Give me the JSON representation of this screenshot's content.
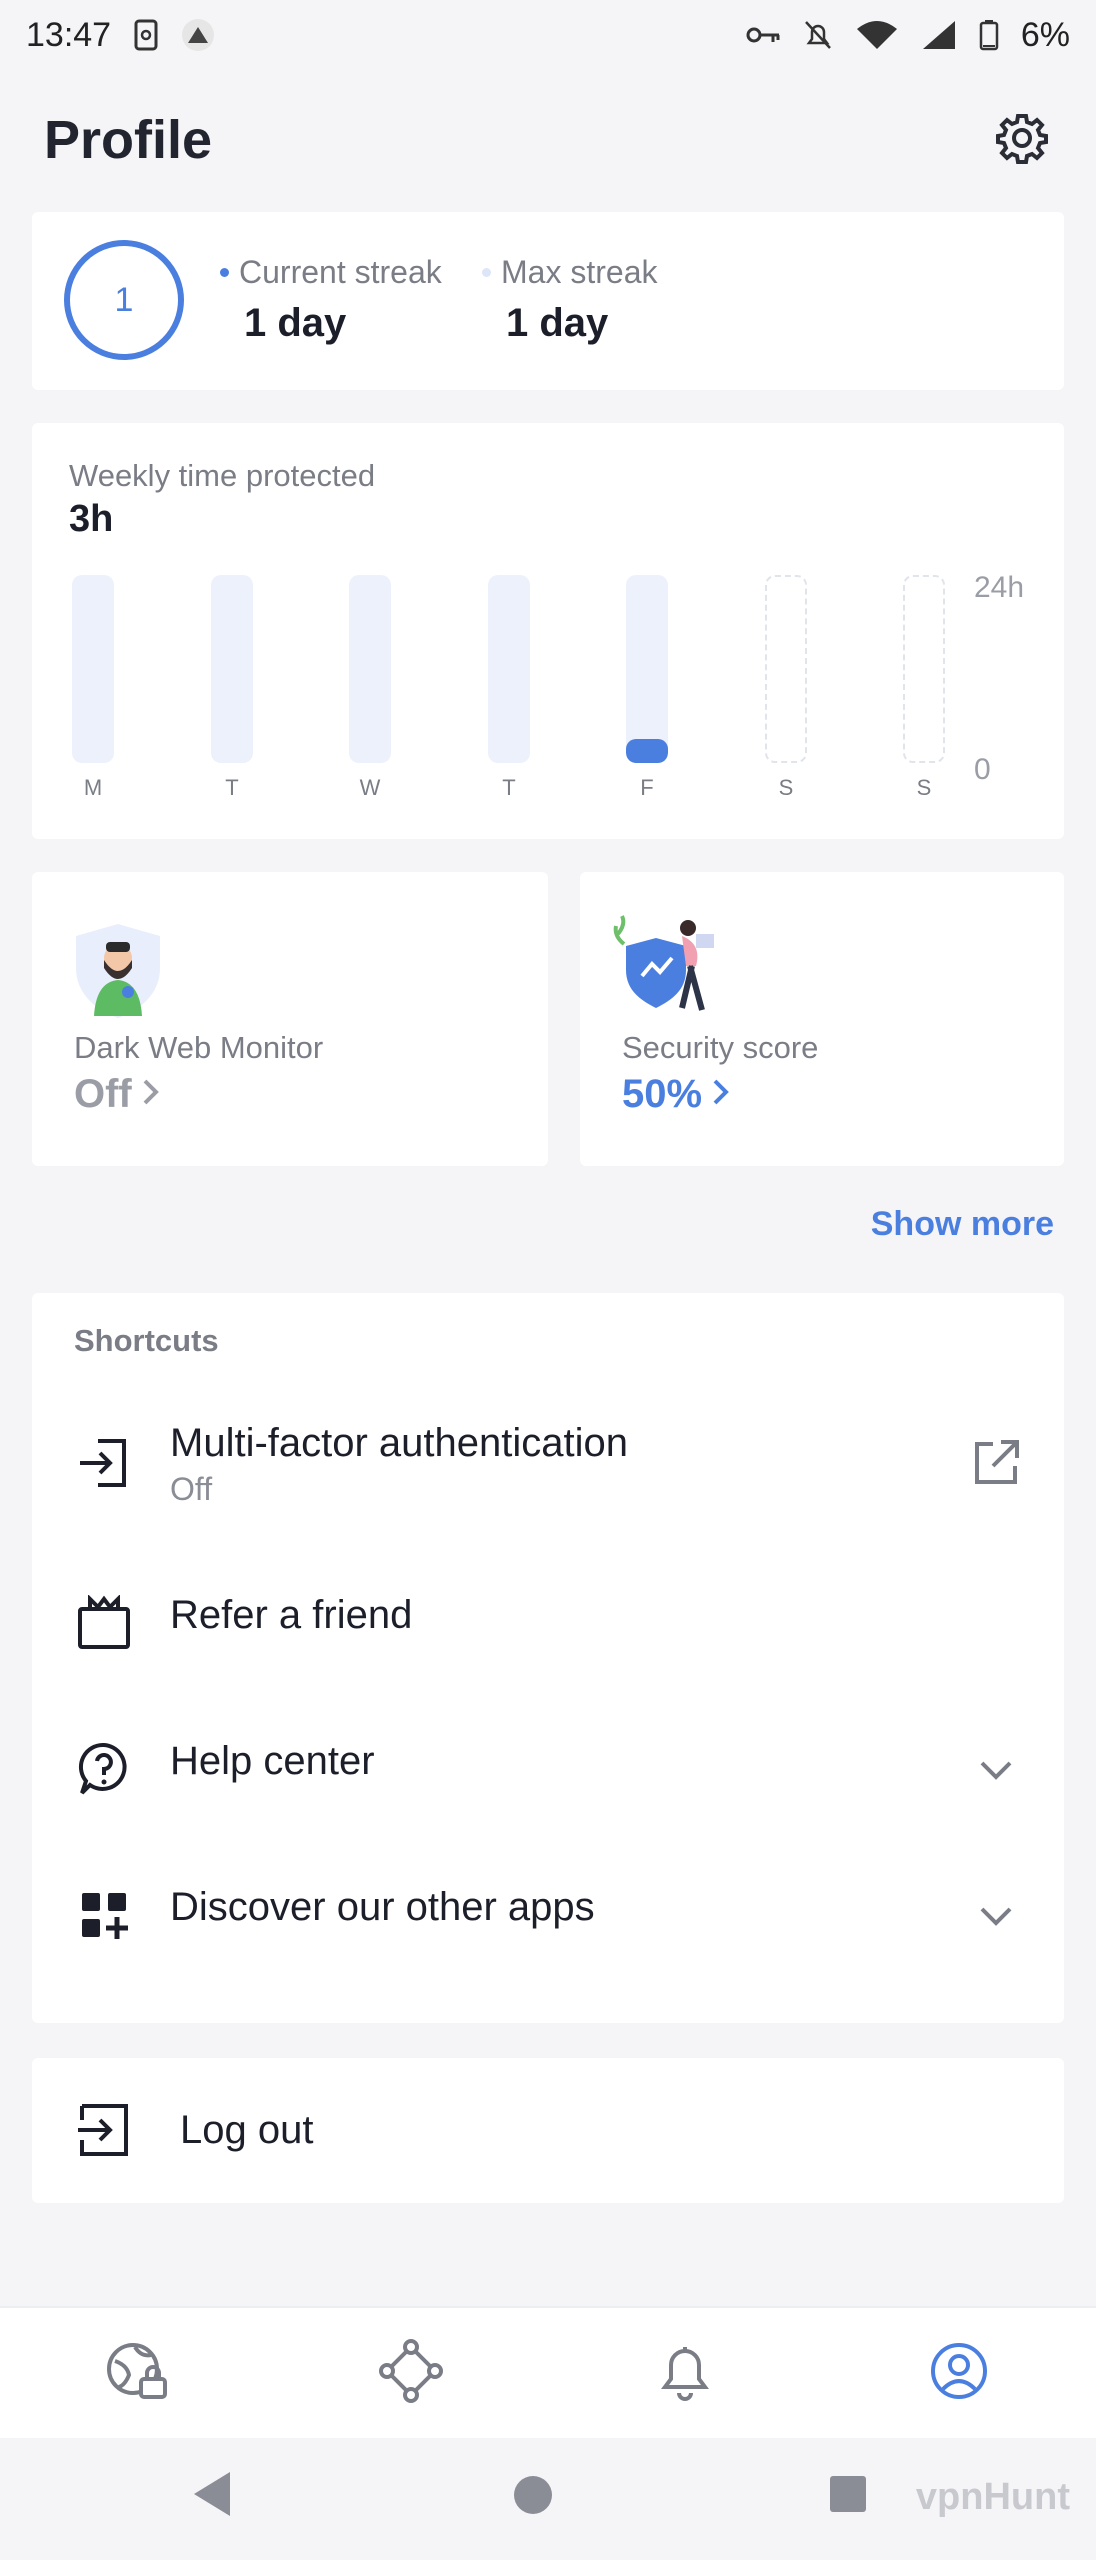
{
  "status_bar": {
    "time": "13:47",
    "battery": "6%"
  },
  "header": {
    "title": "Profile"
  },
  "streak": {
    "count": "1",
    "current_label": "Current streak",
    "current_value": "1 day",
    "max_label": "Max streak",
    "max_value": "1 day"
  },
  "weekly": {
    "title": "Weekly time protected",
    "total": "3h",
    "axis_max": "24h",
    "axis_min": "0",
    "days": [
      {
        "label": "M",
        "hours": 0,
        "future": false
      },
      {
        "label": "T",
        "hours": 0,
        "future": false
      },
      {
        "label": "W",
        "hours": 0,
        "future": false
      },
      {
        "label": "T",
        "hours": 0,
        "future": false
      },
      {
        "label": "F",
        "hours": 3,
        "future": false
      },
      {
        "label": "S",
        "hours": 0,
        "future": true
      },
      {
        "label": "S",
        "hours": 0,
        "future": true
      }
    ]
  },
  "features": {
    "dark_web": {
      "title": "Dark Web Monitor",
      "value": "Off",
      "color": "#9a9da5"
    },
    "security": {
      "title": "Security score",
      "value": "50%",
      "color": "#4a7fe0"
    }
  },
  "show_more": "Show more",
  "shortcuts": {
    "title": "Shortcuts",
    "items": [
      {
        "label": "Multi-factor authentication",
        "sub": "Off",
        "icon": "login-icon",
        "trailing": "external-link-icon"
      },
      {
        "label": "Refer a friend",
        "icon": "gift-icon"
      },
      {
        "label": "Help center",
        "icon": "help-icon",
        "trailing": "chevron-down-icon"
      },
      {
        "label": "Discover our other apps",
        "icon": "apps-add-icon",
        "trailing": "chevron-down-icon"
      }
    ]
  },
  "logout": {
    "label": "Log out"
  },
  "bottom_nav": [
    "globe-lock-icon",
    "nodes-icon",
    "bell-icon",
    "profile-icon"
  ],
  "watermark": "vpnHunt",
  "colors": {
    "accent": "#4a7fe0",
    "background": "#f5f5f7"
  }
}
